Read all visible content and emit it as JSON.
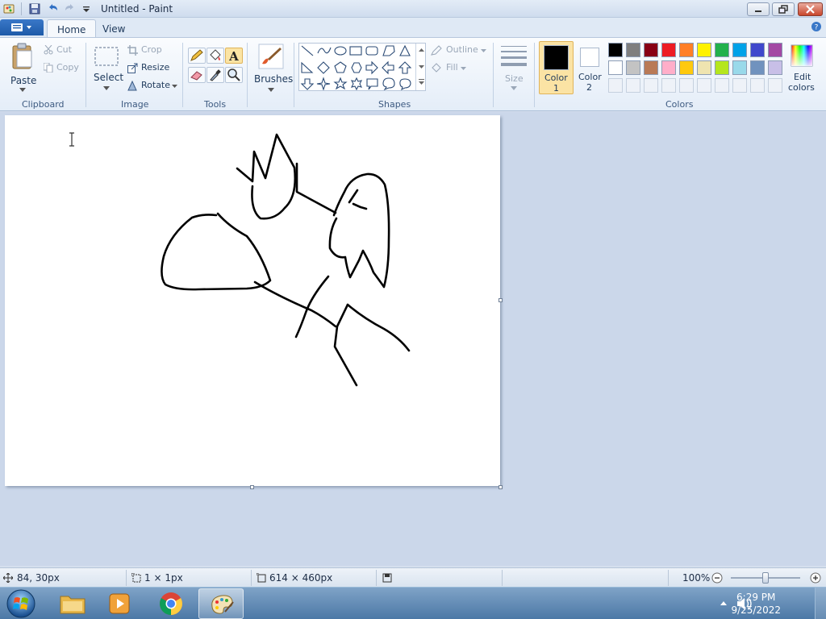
{
  "window": {
    "title": "Untitled - Paint"
  },
  "tabs": [
    {
      "label": "Home"
    },
    {
      "label": "View"
    }
  ],
  "clipboard": {
    "paste": "Paste",
    "cut": "Cut",
    "copy": "Copy",
    "group": "Clipboard"
  },
  "image": {
    "select": "Select",
    "crop": "Crop",
    "resize": "Resize",
    "rotate": "Rotate",
    "group": "Image"
  },
  "tools": {
    "group": "Tools"
  },
  "brushes": {
    "label": "Brushes"
  },
  "shapes": {
    "outline": "Outline",
    "fill": "Fill",
    "group": "Shapes"
  },
  "size": {
    "label": "Size"
  },
  "colors": {
    "color1_line1": "Color",
    "color1_line2": "1",
    "color2_line1": "Color",
    "color2_line2": "2",
    "edit_line1": "Edit",
    "edit_line2": "colors",
    "group": "Colors",
    "color1_value": "#000000",
    "color2_value": "#ffffff",
    "palette": [
      "#000000",
      "#7f7f7f",
      "#880015",
      "#ed1c24",
      "#ff7f27",
      "#fff200",
      "#22b14c",
      "#00a2e8",
      "#3f48cc",
      "#a349a4",
      "#ffffff",
      "#c3c3c3",
      "#b97a57",
      "#ffaec9",
      "#ffc90e",
      "#efe4b0",
      "#b5e61d",
      "#99d9ea",
      "#7092be",
      "#c8bfe7"
    ]
  },
  "status": {
    "cursor_pos": "84, 30px",
    "selection_size": "1 × 1px",
    "canvas_size": "614 × 460px",
    "zoom": "100%"
  },
  "taskbar": {
    "time": "6:29 PM",
    "date": "9/25/2022"
  }
}
